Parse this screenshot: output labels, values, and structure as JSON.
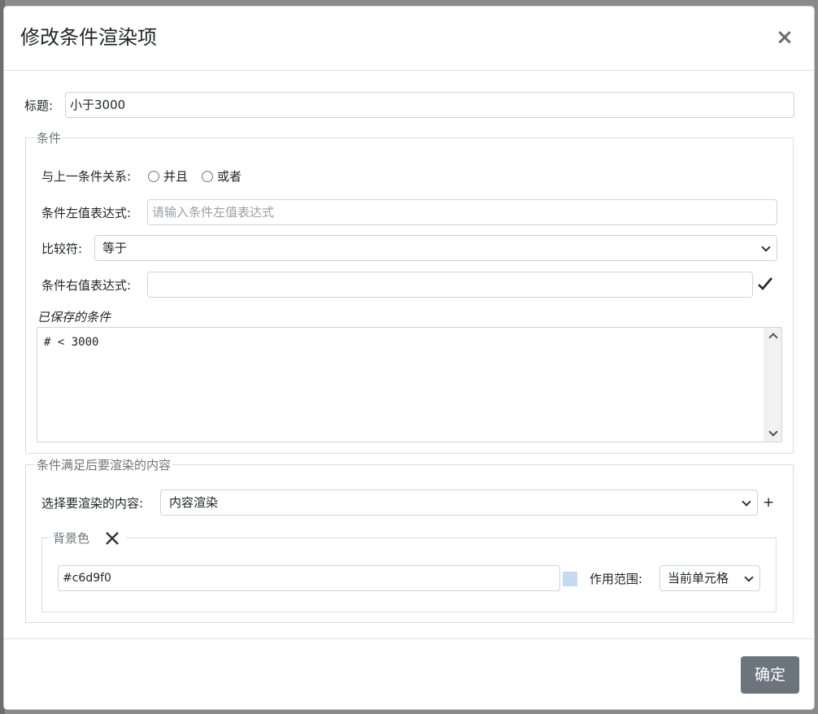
{
  "modal": {
    "title": "修改条件渲染项",
    "close_glyph": "×"
  },
  "form": {
    "title_label": "标题:",
    "title_value": "小于3000"
  },
  "condition": {
    "legend": "条件",
    "relation_label": "与上一条件关系:",
    "relation_options": [
      "并且",
      "或者"
    ],
    "left_label": "条件左值表达式:",
    "left_placeholder": "请输入条件左值表达式",
    "left_value": "",
    "operator_label": "比较符:",
    "operator_value": "等于",
    "right_label": "条件右值表达式:",
    "right_value": "",
    "confirm_icon": "checkmark-icon",
    "saved_label": "已保存的条件",
    "saved_text": "# < 3000"
  },
  "render": {
    "legend": "条件满足后要渲染的内容",
    "select_label": "选择要渲染的内容:",
    "select_value": "内容渲染",
    "add_glyph": "+",
    "bg": {
      "legend": "背景色",
      "remove_icon": "close-icon",
      "color_value": "#c6d9f0",
      "scope_label": "作用范围:",
      "scope_value": "当前单元格"
    }
  },
  "footer": {
    "ok_label": "确定"
  },
  "colors": {
    "swatch": "#c6d9f0",
    "primary_button": "#6c757d"
  }
}
